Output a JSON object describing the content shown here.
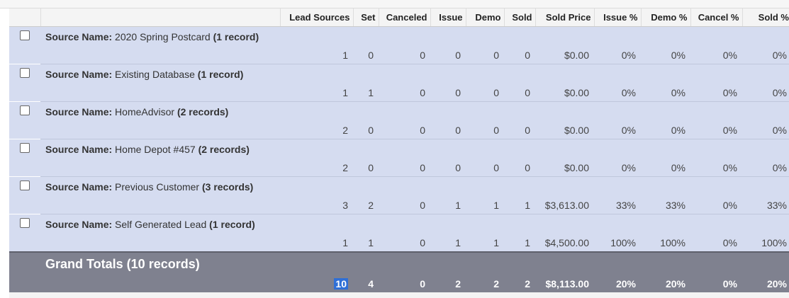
{
  "columns": [
    "Lead Sources",
    "Set",
    "Canceled",
    "Issue",
    "Demo",
    "Sold",
    "Sold Price",
    "Issue %",
    "Demo %",
    "Cancel %",
    "Sold %"
  ],
  "group_prefix": "Source Name:",
  "groups": [
    {
      "name": "2020 Spring Postcard",
      "count": "(1 record)",
      "values": [
        "1",
        "0",
        "0",
        "0",
        "0",
        "0",
        "$0.00",
        "0%",
        "0%",
        "0%",
        "0%"
      ]
    },
    {
      "name": "Existing Database",
      "count": "(1 record)",
      "values": [
        "1",
        "1",
        "0",
        "0",
        "0",
        "0",
        "$0.00",
        "0%",
        "0%",
        "0%",
        "0%"
      ]
    },
    {
      "name": "HomeAdvisor",
      "count": "(2 records)",
      "values": [
        "2",
        "0",
        "0",
        "0",
        "0",
        "0",
        "$0.00",
        "0%",
        "0%",
        "0%",
        "0%"
      ]
    },
    {
      "name": "Home Depot #457",
      "count": "(2 records)",
      "values": [
        "2",
        "0",
        "0",
        "0",
        "0",
        "0",
        "$0.00",
        "0%",
        "0%",
        "0%",
        "0%"
      ]
    },
    {
      "name": "Previous Customer",
      "count": "(3 records)",
      "values": [
        "3",
        "2",
        "0",
        "1",
        "1",
        "1",
        "$3,613.00",
        "33%",
        "33%",
        "0%",
        "33%"
      ]
    },
    {
      "name": "Self Generated Lead",
      "count": "(1 record)",
      "values": [
        "1",
        "1",
        "0",
        "1",
        "1",
        "1",
        "$4,500.00",
        "100%",
        "100%",
        "0%",
        "100%"
      ]
    }
  ],
  "grand_totals": {
    "label": "Grand Totals (10 records)",
    "values": [
      "10",
      "4",
      "0",
      "2",
      "2",
      "2",
      "$8,113.00",
      "20%",
      "20%",
      "0%",
      "20%"
    ]
  },
  "colors": {
    "group_bg": "#d5dcf0",
    "totals_bg": "#7f818f",
    "highlight": "#2f6fd6"
  }
}
